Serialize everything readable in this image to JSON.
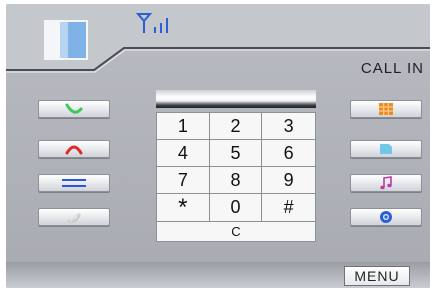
{
  "header": {
    "title": "CALL   IN",
    "signal_icon": "antenna-signal-icon",
    "battery_icon": "battery-icon"
  },
  "left_buttons": [
    {
      "name": "answer-call-button",
      "icon": "phone-answer-icon",
      "color": "#3cc85a"
    },
    {
      "name": "end-call-button",
      "icon": "phone-hangup-icon",
      "color": "#e02a2a"
    },
    {
      "name": "transfer-button",
      "icon": "transfer-arrows-icon",
      "color": "#2a55d8"
    },
    {
      "name": "mute-button",
      "icon": "mute-icon",
      "color": "#d7d7d7"
    }
  ],
  "right_buttons": [
    {
      "name": "keypad-grid-button",
      "icon": "grid-icon",
      "color": "#f08a1e"
    },
    {
      "name": "contacts-button",
      "icon": "contact-card-icon",
      "color": "#6fc9e6"
    },
    {
      "name": "music-button",
      "icon": "music-note-icon",
      "color": "#c03aa8"
    },
    {
      "name": "settings-button",
      "icon": "gear-icon",
      "color": "#2b5fd8"
    }
  ],
  "keypad": {
    "keys": [
      "1",
      "2",
      "3",
      "4",
      "5",
      "6",
      "7",
      "8",
      "9",
      "*",
      "0",
      "#"
    ],
    "clear_label": "C"
  },
  "footer": {
    "menu_label": "MENU"
  },
  "colors": {
    "screen_bg": "#b0b3b9",
    "accent_blue": "#2b5fd8"
  }
}
